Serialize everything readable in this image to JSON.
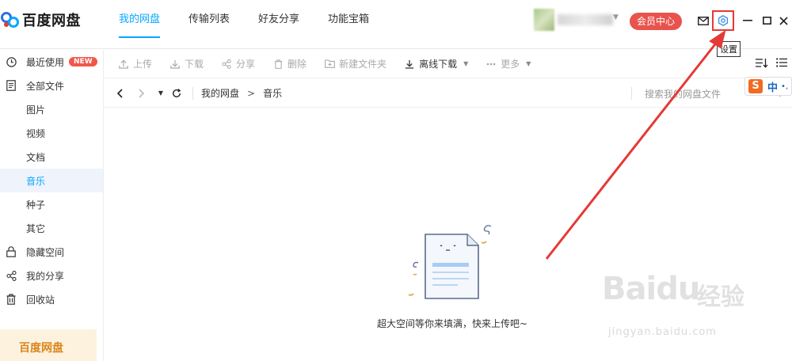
{
  "app": {
    "logo_text": "百度网盘"
  },
  "nav": {
    "tabs": [
      {
        "label": "我的网盘",
        "active": true
      },
      {
        "label": "传输列表",
        "active": false
      },
      {
        "label": "好友分享",
        "active": false
      },
      {
        "label": "功能宝箱",
        "active": false
      }
    ]
  },
  "header": {
    "vip_label": "会员中心",
    "settings_tooltip": "设置"
  },
  "sidebar": {
    "items": [
      {
        "label": "最近使用",
        "icon": "clock-icon",
        "badge": "NEW"
      },
      {
        "label": "全部文件",
        "icon": "document-icon"
      },
      {
        "label": "图片",
        "sub": true
      },
      {
        "label": "视频",
        "sub": true
      },
      {
        "label": "文档",
        "sub": true
      },
      {
        "label": "音乐",
        "sub": true,
        "active": true
      },
      {
        "label": "种子",
        "sub": true
      },
      {
        "label": "其它",
        "sub": true
      },
      {
        "label": "隐藏空间",
        "icon": "lock-icon"
      },
      {
        "label": "我的分享",
        "icon": "share-icon"
      },
      {
        "label": "回收站",
        "icon": "trash-icon"
      }
    ],
    "promo_title": "百度网盘"
  },
  "toolbar": {
    "upload": "上传",
    "download": "下载",
    "share": "分享",
    "delete": "删除",
    "new_folder": "新建文件夹",
    "offline_download": "离线下载",
    "more": "更多"
  },
  "breadcrumb": {
    "root": "我的网盘",
    "separator": ">",
    "current": "音乐"
  },
  "search": {
    "placeholder": "搜索我的网盘文件"
  },
  "ime": {
    "logo": "S",
    "mode": "中"
  },
  "empty_state": {
    "message": "超大空间等你来填满，快来上传吧~"
  },
  "watermark": {
    "brand": "Baidu",
    "brand_cn": "经验",
    "url": "jingyan.baidu.com"
  },
  "colors": {
    "accent": "#06a7ff",
    "vip": "#e8534d",
    "annotation": "#e53935"
  }
}
